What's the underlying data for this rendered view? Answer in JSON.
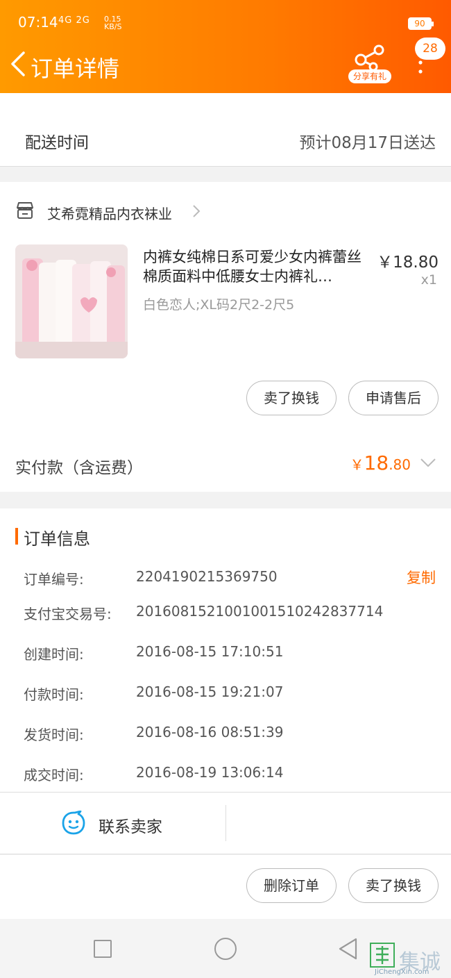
{
  "status_bar": {
    "time": "07:14",
    "network": "4G 2G",
    "speed_value": "0.15",
    "speed_unit": "KB/S",
    "battery": "90"
  },
  "header": {
    "title": "订单详情",
    "share_label": "分享有礼",
    "badge_count": "28"
  },
  "delivery": {
    "label": "配送时间",
    "value": "预计08月17日送达"
  },
  "shop": {
    "name": "艾希霓精品内衣袜业"
  },
  "product": {
    "title": "内裤女纯棉日系可爱少女内裤蕾丝棉质面料中低腰女士内裤礼…",
    "sku": "白色恋人;XL码2尺2-2尺5",
    "price": "￥18.80",
    "quantity": "x1"
  },
  "item_actions": {
    "sell": "卖了换钱",
    "after_sale": "申请售后"
  },
  "payment": {
    "label": "实付款（含运费）",
    "currency": "￥",
    "amount_int": "18",
    "amount_dec": ".80"
  },
  "order_info": {
    "title": "订单信息",
    "copy_label": "复制",
    "rows": [
      {
        "label": "订单编号:",
        "value": "2204190215369750"
      },
      {
        "label": "支付宝交易号:",
        "value": "2016081521001001510242837714"
      },
      {
        "label": "创建时间:",
        "value": "2016-08-15 17:10:51"
      },
      {
        "label": "付款时间:",
        "value": "2016-08-15 19:21:07"
      },
      {
        "label": "发货时间:",
        "value": "2016-08-16 08:51:39"
      },
      {
        "label": "成交时间:",
        "value": "2016-08-19 13:06:14"
      }
    ]
  },
  "contact": {
    "label": "联系卖家"
  },
  "bottom_actions": {
    "delete": "删除订单",
    "sell": "卖了换钱"
  },
  "watermark": {
    "text": "集诚信",
    "url": "JiChengXin.com"
  },
  "colors": {
    "accent": "#ff6a00",
    "header_start": "#ff9a00",
    "header_end": "#ff5a00",
    "contact_icon": "#1aa3e8"
  },
  "icons": [
    "back-icon",
    "share-icon",
    "more-icon",
    "shop-icon",
    "chevron-right-icon",
    "chevron-down-icon",
    "chat-icon",
    "nav-recent-icon",
    "nav-home-icon",
    "nav-back-icon"
  ]
}
